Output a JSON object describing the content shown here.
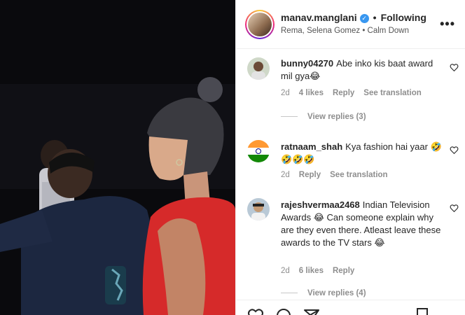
{
  "post": {
    "username": "manav.manglani",
    "following_label": "Following",
    "subtitle": "Rema, Selena Gomez • Calm Down",
    "more_label": "•••"
  },
  "comments": [
    {
      "username": "bunny04270",
      "text": "Abe inko kis baat award mil gya😂",
      "time": "2d",
      "likes": "4 likes",
      "reply": "Reply",
      "translate": "See translation",
      "view_replies": "View replies (3)"
    },
    {
      "username": "ratnaam_shah",
      "text": "Kya fashion hai yaar 🤣🤣🤣🤣",
      "time": "2d",
      "reply": "Reply",
      "translate": "See translation"
    },
    {
      "username": "rajeshvermaa2468",
      "text": "Indian Television Awards 😂 Can someone explain why are they even there. Atleast leave these awards to the TV stars 😂",
      "time": "2d",
      "likes": "6 likes",
      "reply": "Reply",
      "view_replies": "View replies (4)"
    }
  ],
  "icons": [
    "heart-icon",
    "comment-icon",
    "share-icon",
    "bookmark-icon",
    "verified-icon",
    "more-icon"
  ],
  "colors": {
    "verified": "#3897f0",
    "meta_text": "#8e8e8e",
    "dress": "#d62a2a"
  }
}
